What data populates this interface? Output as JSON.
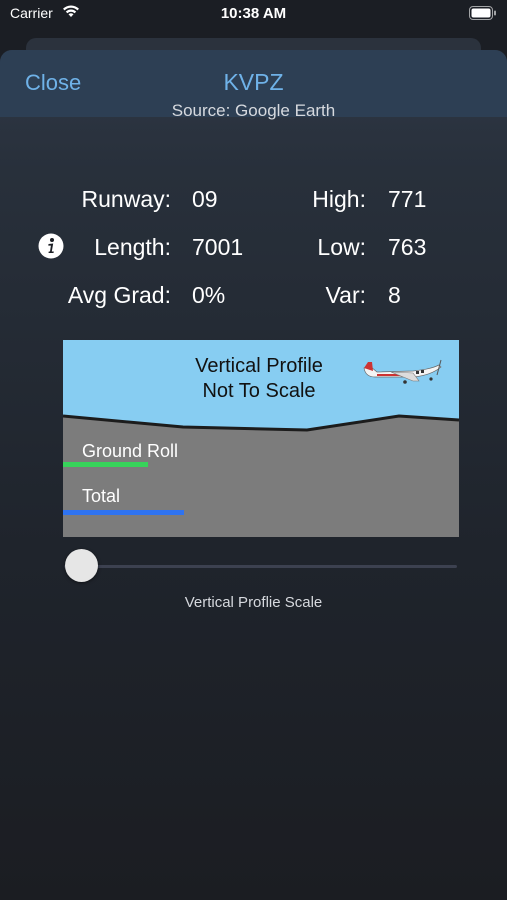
{
  "status_bar": {
    "carrier": "Carrier",
    "time": "10:38 AM"
  },
  "nav": {
    "close_label": "Close",
    "title": "KVPZ"
  },
  "source": "Source: Google Earth",
  "stats": {
    "runway_label": "Runway:",
    "runway_value": "09",
    "high_label": "High:",
    "high_value": "771",
    "length_label": "Length:",
    "length_value": "7001",
    "low_label": "Low:",
    "low_value": "763",
    "avg_grad_label": "Avg Grad:",
    "avg_grad_value": "0%",
    "var_label": "Var:",
    "var_value": "8"
  },
  "profile": {
    "title_line1": "Vertical Profile",
    "title_line2": "Not To Scale",
    "ground_roll_label": "Ground Roll",
    "total_label": "Total",
    "ground_roll_fraction": 0.215,
    "total_fraction": 0.305,
    "colors": {
      "sky": "#87cdf2",
      "ground": "#7c7c7c",
      "ground_roll": "#37d35a",
      "total": "#2f73f0"
    }
  },
  "slider": {
    "caption": "Vertical Proflie Scale",
    "value": 0
  }
}
